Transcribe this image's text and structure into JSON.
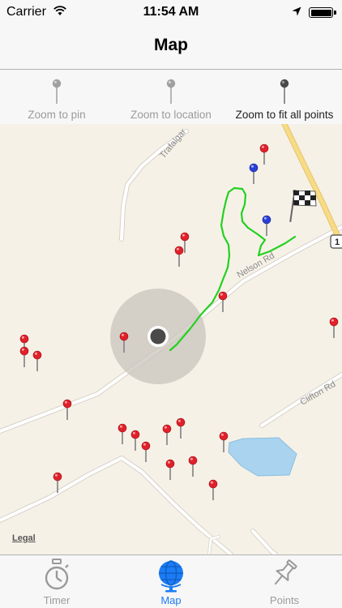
{
  "status": {
    "carrier": "Carrier",
    "time": "11:54 AM"
  },
  "nav": {
    "title": "Map"
  },
  "toolbar": {
    "items": [
      {
        "label": "Zoom to pin",
        "icon": "pin-icon"
      },
      {
        "label": "Zoom to location",
        "icon": "pin-icon"
      },
      {
        "label": "Zoom to fit all points",
        "icon": "pin-icon"
      }
    ]
  },
  "map": {
    "roads": [
      "Trafalgar",
      "Nelson Rd",
      "Clifton Rd",
      "1"
    ],
    "legal": "Legal",
    "colors": {
      "track": "#22d11f",
      "red_pin": "#e0202a",
      "blue_pin": "#2a3fd6",
      "water": "#a9d3ee",
      "land": "#f6f1e7"
    }
  },
  "tabs": [
    {
      "label": "Timer",
      "icon": "stopwatch-icon"
    },
    {
      "label": "Map",
      "icon": "globe-icon"
    },
    {
      "label": "Points",
      "icon": "pushpin-icon"
    }
  ]
}
